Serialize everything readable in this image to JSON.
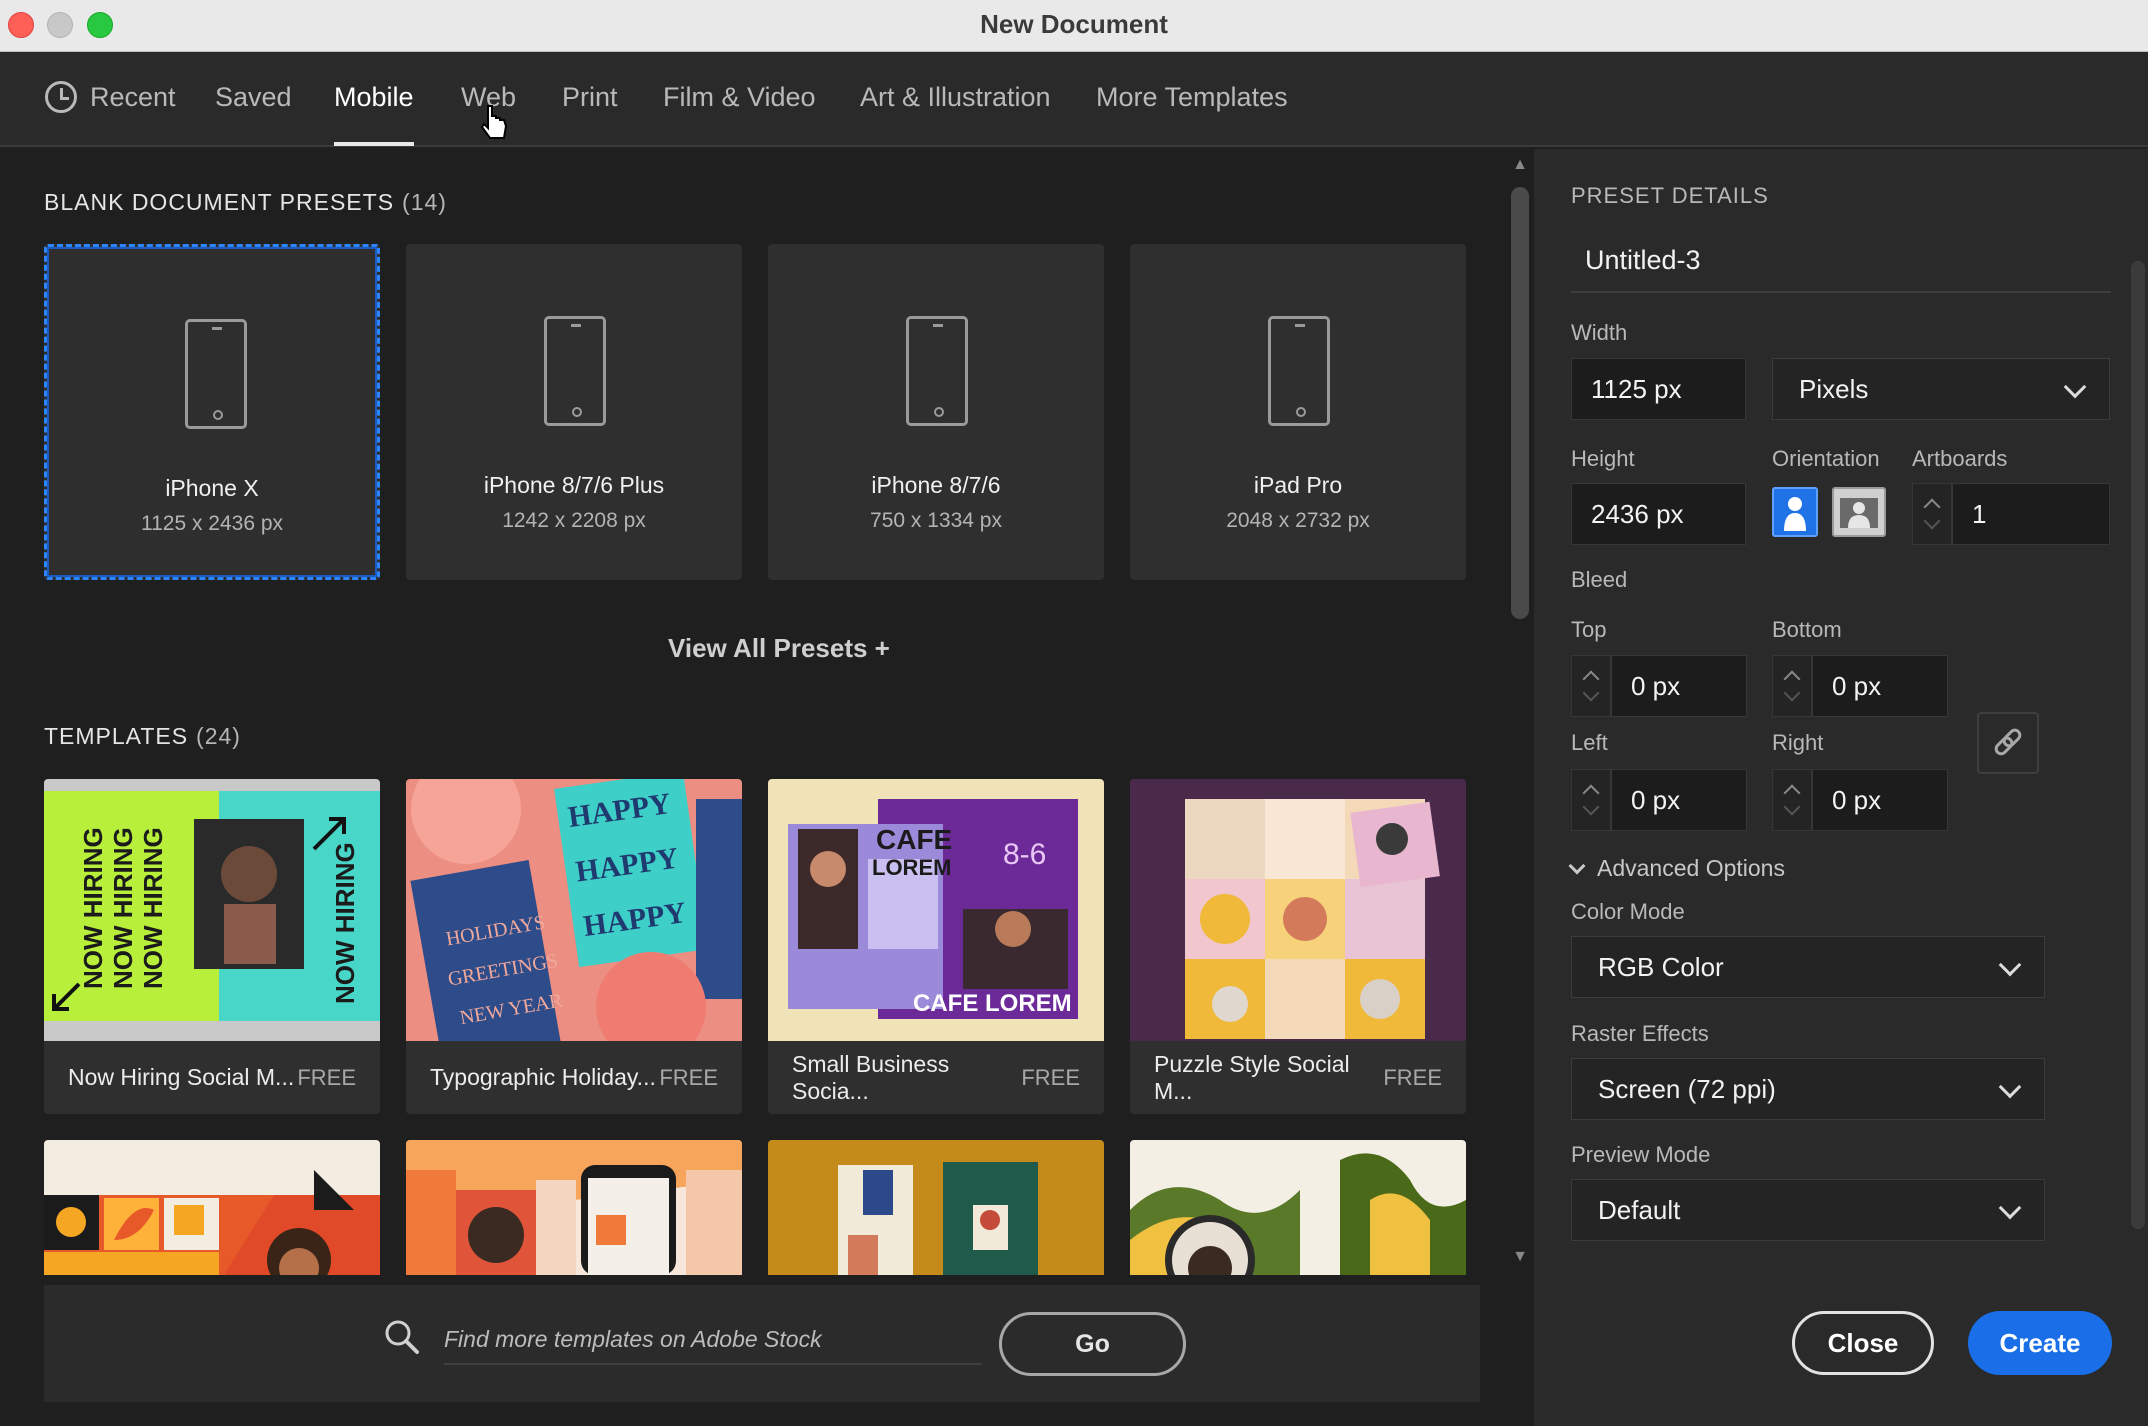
{
  "window": {
    "title": "New Document"
  },
  "tabs": [
    {
      "label": "Recent"
    },
    {
      "label": "Saved"
    },
    {
      "label": "Mobile"
    },
    {
      "label": "Web"
    },
    {
      "label": "Print"
    },
    {
      "label": "Film & Video"
    },
    {
      "label": "Art & Illustration"
    },
    {
      "label": "More Templates"
    }
  ],
  "active_tab": "Mobile",
  "blank_presets": {
    "title": "BLANK DOCUMENT PRESETS",
    "count": "(14)",
    "items": [
      {
        "name": "iPhone X",
        "size": "1125 x 2436 px",
        "selected": true
      },
      {
        "name": "iPhone 8/7/6 Plus",
        "size": "1242 x 2208 px",
        "selected": false
      },
      {
        "name": "iPhone 8/7/6",
        "size": "750 x 1334 px",
        "selected": false
      },
      {
        "name": "iPad Pro",
        "size": "2048 x 2732 px",
        "selected": false
      }
    ],
    "view_all": "View All Presets +"
  },
  "templates": {
    "title": "TEMPLATES",
    "count": "(24)",
    "items": [
      {
        "name": "Now Hiring Social M...",
        "price": "FREE"
      },
      {
        "name": "Typographic Holiday...",
        "price": "FREE"
      },
      {
        "name": "Small Business Socia...",
        "price": "FREE"
      },
      {
        "name": "Puzzle Style Social M...",
        "price": "FREE"
      }
    ]
  },
  "search": {
    "placeholder": "Find more templates on Adobe Stock",
    "go_label": "Go"
  },
  "preset_details": {
    "title": "PRESET DETAILS",
    "doc_name": "Untitled-3",
    "width_label": "Width",
    "width_value": "1125 px",
    "units": "Pixels",
    "height_label": "Height",
    "height_value": "2436 px",
    "orientation_label": "Orientation",
    "orientation": "portrait",
    "artboards_label": "Artboards",
    "artboards_value": "1",
    "bleed_label": "Bleed",
    "top_label": "Top",
    "top_value": "0 px",
    "bottom_label": "Bottom",
    "bottom_value": "0 px",
    "left_label": "Left",
    "left_value": "0 px",
    "right_label": "Right",
    "right_value": "0 px",
    "advanced_label": "Advanced Options",
    "color_mode_label": "Color Mode",
    "color_mode_value": "RGB Color",
    "raster_label": "Raster Effects",
    "raster_value": "Screen (72 ppi)",
    "preview_label": "Preview Mode",
    "preview_value": "Default"
  },
  "actions": {
    "close": "Close",
    "create": "Create"
  },
  "colors": {
    "accent": "#1a6fe8",
    "selection": "#2d86ff"
  }
}
